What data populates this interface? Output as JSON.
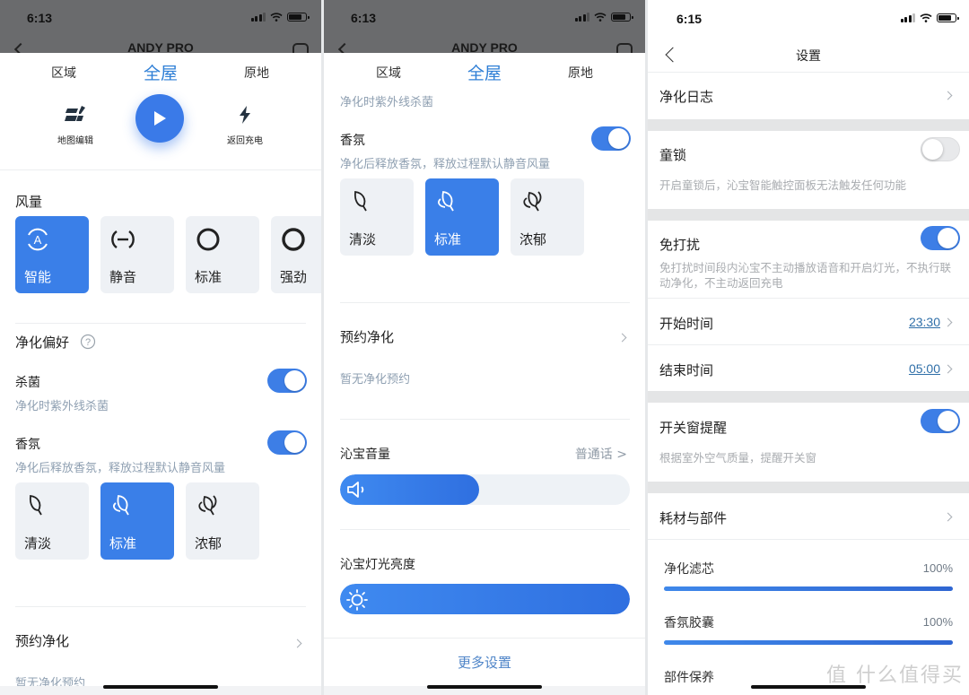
{
  "colors": {
    "accent": "#3a7fe8",
    "toggle_on": "#3d7ee6",
    "toggle_off": "#e8e9eb",
    "subtext": "#8fa0b2",
    "dim_overlay": "#6a6b6d",
    "link": "#2f6fa8"
  },
  "panel1": {
    "status": {
      "time": "6:13",
      "icons": [
        "signal-icon",
        "wifi-icon",
        "battery-icon"
      ]
    },
    "header": {
      "title": "ANDY PRO",
      "back_icon": "back-icon",
      "settings_icon": "gear-icon"
    },
    "mode_tabs": [
      {
        "label": "区域",
        "active": false
      },
      {
        "label": "全屋",
        "active": true
      },
      {
        "label": "原地",
        "active": false
      }
    ],
    "actions": {
      "map_edit": {
        "label": "地图编辑",
        "icon": "map-edit-icon"
      },
      "play": {
        "icon": "play-icon"
      },
      "recharge": {
        "label": "返回充电",
        "icon": "lightning-icon"
      }
    },
    "fan": {
      "title": "风量",
      "options": [
        {
          "label": "智能",
          "icon": "auto-icon",
          "selected": true
        },
        {
          "label": "静音",
          "icon": "silent-icon",
          "selected": false
        },
        {
          "label": "标准",
          "icon": "fan-standard-icon",
          "selected": false
        },
        {
          "label": "强劲",
          "icon": "fan-strong-icon",
          "selected": false
        }
      ]
    },
    "preference": {
      "title": "净化偏好",
      "help_icon": "help-icon",
      "sterilize": {
        "title": "杀菌",
        "subtitle": "净化时紫外线杀菌",
        "on": true
      },
      "fragrance": {
        "title": "香氛",
        "subtitle": "净化后释放香氛，释放过程默认静音风量",
        "on": true
      },
      "fragrance_levels": [
        {
          "label": "清淡",
          "icon": "leaf-light-icon",
          "selected": false
        },
        {
          "label": "标准",
          "icon": "leaf-standard-icon",
          "selected": true
        },
        {
          "label": "浓郁",
          "icon": "leaf-rich-icon",
          "selected": false
        }
      ]
    },
    "schedule": {
      "title": "预约净化",
      "empty": "暂无净化预约"
    }
  },
  "panel2": {
    "status": {
      "time": "6:13"
    },
    "header": {
      "title": "ANDY PRO"
    },
    "mode_tabs": [
      {
        "label": "区域",
        "active": false
      },
      {
        "label": "全屋",
        "active": true
      },
      {
        "label": "原地",
        "active": false
      }
    ],
    "sterilize_subtitle": "净化时紫外线杀菌",
    "fragrance": {
      "title": "香氛",
      "subtitle": "净化后释放香氛，释放过程默认静音风量",
      "on": true
    },
    "fragrance_levels": [
      {
        "label": "清淡",
        "selected": false
      },
      {
        "label": "标准",
        "selected": true
      },
      {
        "label": "浓郁",
        "selected": false
      }
    ],
    "schedule": {
      "title": "预约净化",
      "empty": "暂无净化预约"
    },
    "volume": {
      "title": "沁宝音量",
      "voice": "普通话 >",
      "level": 0.48,
      "icon": "speaker-icon"
    },
    "brightness": {
      "title": "沁宝灯光亮度",
      "level": 1.0,
      "icon": "sun-icon"
    },
    "more_settings": "更多设置"
  },
  "panel3": {
    "status": {
      "time": "6:15"
    },
    "header": {
      "title": "设置",
      "back_icon": "back-icon"
    },
    "log": {
      "title": "净化日志"
    },
    "child_lock": {
      "title": "童锁",
      "subtitle": "开启童锁后，沁宝智能触控面板无法触发任何功能",
      "on": false
    },
    "dnd": {
      "title": "免打扰",
      "subtitle": "免打扰时间段内沁宝不主动播放语音和开启灯光，不执行联动净化，不主动返回充电",
      "on": true
    },
    "start_time": {
      "title": "开始时间",
      "value": "23:30"
    },
    "end_time": {
      "title": "结束时间",
      "value": "05:00"
    },
    "window_reminder": {
      "title": "开关窗提醒",
      "subtitle": "根据室外空气质量，提醒开关窗",
      "on": true
    },
    "consumables": {
      "title": "耗材与部件",
      "items": [
        {
          "name": "净化滤芯",
          "percent_label": "100%",
          "level": 1.0
        },
        {
          "name": "香氛胶囊",
          "percent_label": "100%",
          "level": 1.0
        },
        {
          "name": "部件保养",
          "percent_label": ""
        }
      ]
    },
    "watermark": "值 什么值得买"
  }
}
